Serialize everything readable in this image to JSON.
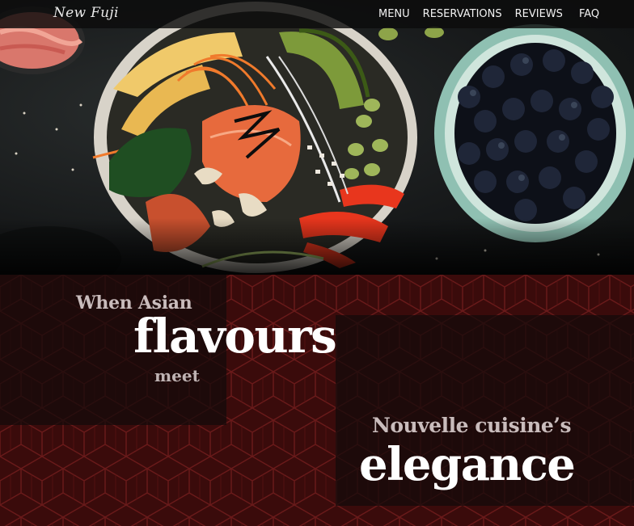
{
  "navbar": {
    "logo": "New Fuji",
    "links": [
      "MENU",
      "RESERVATIONS",
      "REVIEWS",
      "FAQ"
    ]
  },
  "hero": {
    "image_alt": "poke-bowl-and-blueberries-photo"
  },
  "tagline": {
    "line1": "When Asian",
    "line2": "flavours",
    "line3": "meet",
    "line4": "Nouvelle cuisine’s",
    "line5": "elegance"
  },
  "colors": {
    "navbar_bg": "#0c0c0c",
    "pattern_bg": "#3a0b0b",
    "pattern_line": "#6a1a1a",
    "text_light": "#ffffff",
    "text_muted": "#c9bcbc"
  }
}
